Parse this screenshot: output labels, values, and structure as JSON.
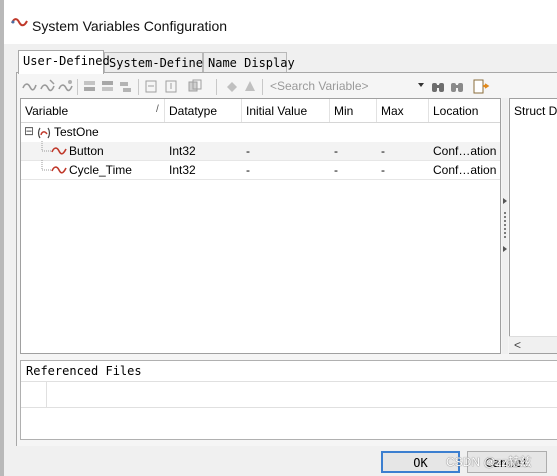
{
  "window": {
    "title": "System Variables Configuration",
    "icon": "system-variable-icon"
  },
  "tabs": [
    {
      "label": "User-Defined",
      "active": true
    },
    {
      "label": "System-Defined",
      "active": false
    },
    {
      "label": "Name Display",
      "active": false
    }
  ],
  "toolbar": {
    "search_placeholder": "<Search Variable>",
    "icons": [
      "new-variable-icon",
      "new-struct-icon",
      "new-member-icon",
      "insert-above-icon",
      "insert-below-icon",
      "insert-child-icon",
      "import-icon",
      "export-icon",
      "copy-icon",
      "undo-icon",
      "redo-icon",
      "find-icon",
      "find-next-icon",
      "options-icon"
    ]
  },
  "grid": {
    "columns": [
      "Variable",
      "Datatype",
      "Initial Value",
      "Min",
      "Max",
      "Location"
    ],
    "sort_indicator": "/",
    "group": {
      "name": "TestOne",
      "expanded": true,
      "expander": "⊟"
    },
    "rows": [
      {
        "name": "Button",
        "datatype": "Int32",
        "initial": "-",
        "min": "-",
        "max": "-",
        "location": "Conf…ation"
      },
      {
        "name": "Cycle_Time",
        "datatype": "Int32",
        "initial": "-",
        "min": "-",
        "max": "-",
        "location": "Conf…ation"
      }
    ]
  },
  "struct_pane": {
    "header": "Struct D",
    "scroll_left": "<"
  },
  "referenced_files": {
    "title": "Referenced Files"
  },
  "buttons": {
    "ok": "OK",
    "cancel": "Cancel"
  },
  "watermark": "CSDN @zz赫兹",
  "colors": {
    "accent": "#c0392b",
    "default_button_border": "#3c7fd0"
  }
}
